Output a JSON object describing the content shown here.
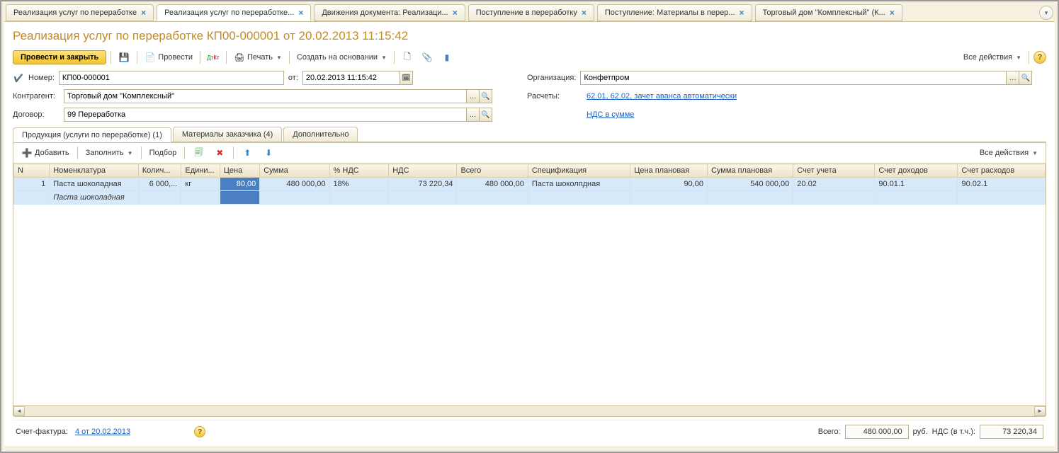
{
  "tabs": [
    {
      "label": "Реализация услуг по переработке",
      "closable": true
    },
    {
      "label": "Реализация услуг по переработке...",
      "closable": true,
      "active": true
    },
    {
      "label": "Движения документа: Реализаци...",
      "closable": true
    },
    {
      "label": "Поступление в переработку",
      "closable": true
    },
    {
      "label": "Поступление: Материалы в перер...",
      "closable": true
    },
    {
      "label": "Торговый дом \"Комплексный\" (К...",
      "closable": true
    }
  ],
  "doc_title": "Реализация услуг по переработке КП00-000001 от 20.02.2013 11:15:42",
  "toolbar": {
    "post_close": "Провести и закрыть",
    "post": "Провести",
    "print": "Печать",
    "create_based": "Создать на основании",
    "all_actions": "Все действия"
  },
  "form": {
    "number_label": "Номер:",
    "number_value": "КП00-000001",
    "date_label": "от:",
    "date_value": "20.02.2013 11:15:42",
    "org_label": "Организация:",
    "org_value": "Конфетпром",
    "contr_label": "Контрагент:",
    "contr_value": "Торговый дом \"Комплексный\"",
    "settle_label": "Расчеты:",
    "settle_link": "62.01, 62.02, зачет аванса автоматически",
    "dog_label": "Договор:",
    "dog_value": "99 Переработка",
    "vat_link": "НДС в сумме"
  },
  "sub_tabs": [
    {
      "label": "Продукция (услуги по переработке) (1)",
      "active": true
    },
    {
      "label": "Материалы заказчика (4)"
    },
    {
      "label": "Дополнительно"
    }
  ],
  "grid_toolbar": {
    "add": "Добавить",
    "fill": "Заполнить",
    "select": "Подбор",
    "all_actions": "Все действия"
  },
  "grid": {
    "headers": [
      "N",
      "Номенклатура",
      "Колич...",
      "Едини...",
      "Цена",
      "Сумма",
      "% НДС",
      "НДС",
      "Всего",
      "Спецификация",
      "Цена плановая",
      "Сумма плановая",
      "Счет учета",
      "Счет доходов",
      "Счет расходов"
    ],
    "row": {
      "n": "1",
      "nomen": "Паста шоколадная",
      "nomen_sub": "Паста шоколадная",
      "qty": "6 000,...",
      "unit": "кг",
      "price": "80,00",
      "sum": "480 000,00",
      "vat_pct": "18%",
      "vat": "73 220,34",
      "total": "480 000,00",
      "spec": "Паста шоколпдная",
      "price_plan": "90,00",
      "sum_plan": "540 000,00",
      "acc": "20.02",
      "acc_inc": "90.01.1",
      "acc_exp": "90.02.1"
    }
  },
  "footer": {
    "sf_label": "Счет-фактура:",
    "sf_link": "4 от 20.02.2013",
    "total_label": "Всего:",
    "total_value": "480 000,00",
    "currency": "руб.",
    "vat_label": "НДС (в т.ч.):",
    "vat_value": "73 220,34"
  }
}
